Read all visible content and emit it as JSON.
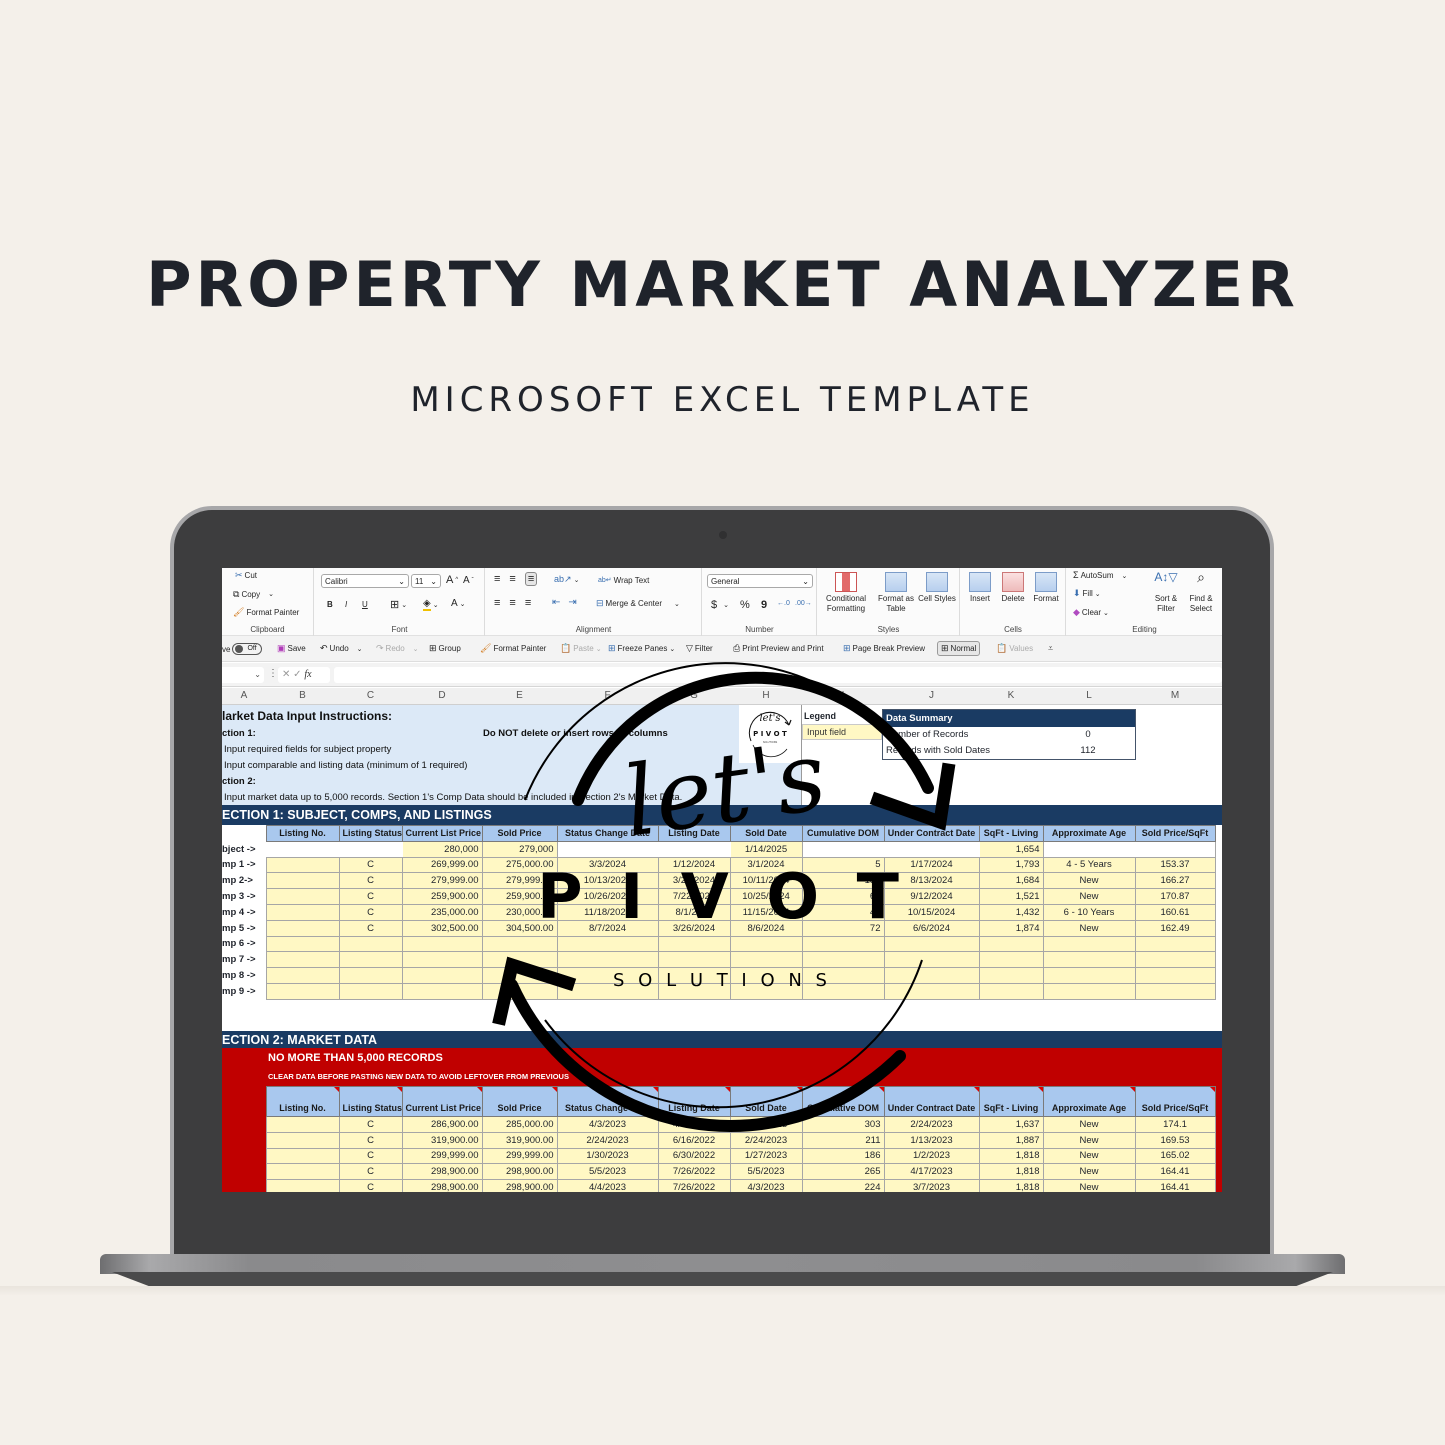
{
  "hero": {
    "title": "PROPERTY MARKET ANALYZER",
    "subtitle": "MICROSOFT EXCEL TEMPLATE"
  },
  "ribbon": {
    "clipboard": {
      "cut": "Cut",
      "copy": "Copy",
      "format_painter": "Format Painter",
      "label": "Clipboard"
    },
    "font": {
      "name": "Calibri",
      "size": "11",
      "label": "Font",
      "bold": "B",
      "italic": "I",
      "underline": "U"
    },
    "alignment": {
      "wrap_text": "Wrap Text",
      "merge_center": "Merge & Center",
      "label": "Alignment"
    },
    "number": {
      "format": "General",
      "label": "Number",
      "currency": "$",
      "percent": "%",
      "comma": "9"
    },
    "styles": {
      "conditional_formatting": "Conditional Formatting",
      "format_as_table": "Format as Table",
      "cell_styles": "Cell Styles",
      "label": "Styles"
    },
    "cells": {
      "insert": "Insert",
      "delete": "Delete",
      "format": "Format",
      "label": "Cells"
    },
    "editing": {
      "autosum": "AutoSum",
      "fill": "Fill",
      "clear": "Clear",
      "sort_filter": "Sort & Filter",
      "find_select": "Find & Select",
      "label": "Editing"
    }
  },
  "quick_access": {
    "autosave_partial": "ve",
    "autosave_state": "Off",
    "save": "Save",
    "undo": "Undo",
    "redo": "Redo",
    "group": "Group",
    "format_painter": "Format Painter",
    "paste": "Paste",
    "freeze_panes": "Freeze Panes",
    "filter": "Filter",
    "print_preview": "Print Preview and Print",
    "page_break_preview": "Page Break Preview",
    "normal": "Normal",
    "values": "Values"
  },
  "formula_bar": {
    "fx": "fx",
    "value": ""
  },
  "columns": [
    "A",
    "B",
    "C",
    "D",
    "E",
    "F",
    "G",
    "H",
    "I",
    "J",
    "K",
    "L",
    "M"
  ],
  "instructions": {
    "title": "larket Data Input Instructions:",
    "section1": "ction 1:",
    "warning": "Do NOT delete or insert rows or columns",
    "step1": "Input required fields for subject property",
    "step2": "Input comparable and listing data (minimum of 1 required)",
    "section2": "ction 2:",
    "step3": "Input market data up to 5,000 records. Section 1's Comp Data should be included in Section 2's Market Data."
  },
  "legend": {
    "title": "Legend",
    "input_field": "Input field"
  },
  "data_summary": {
    "title": "Data Summary",
    "rows": [
      {
        "label": "Number of Records",
        "value": "0"
      },
      {
        "label": "Records with Sold Dates",
        "value": "112"
      }
    ]
  },
  "section1": {
    "title": "ECTION 1: SUBJECT, COMPS, AND LISTINGS",
    "headers": [
      "Listing No.",
      "Listing Status",
      "Current List Price",
      "Sold Price",
      "Status Change Date",
      "Listing Date",
      "Sold Date",
      "Cumulative DOM",
      "Under Contract Date",
      "SqFt - Living",
      "Approximate Age",
      "Sold Price/SqFt"
    ],
    "rows": [
      {
        "label": "bject ->",
        "cells": [
          "",
          "",
          "280,000",
          "279,000",
          "",
          "",
          "1/14/2025",
          "",
          "",
          "1,654",
          "",
          ""
        ]
      },
      {
        "label": "mp 1 ->",
        "cells": [
          "",
          "C",
          "269,999.00",
          "275,000.00",
          "3/3/2024",
          "1/12/2024",
          "3/1/2024",
          "5",
          "1/17/2024",
          "1,793",
          "4 - 5 Years",
          "153.37"
        ]
      },
      {
        "label": "mp 2->",
        "cells": [
          "",
          "C",
          "279,999.00",
          "279,999.00",
          "10/13/2024",
          "3/27/2024",
          "10/11/2024",
          "152",
          "8/13/2024",
          "1,684",
          "New",
          "166.27"
        ]
      },
      {
        "label": "mp 3 ->",
        "cells": [
          "",
          "C",
          "259,900.00",
          "259,900.00",
          "10/26/2024",
          "7/22/2024",
          "10/25/2024",
          "68",
          "9/12/2024",
          "1,521",
          "New",
          "170.87"
        ]
      },
      {
        "label": "mp 4 ->",
        "cells": [
          "",
          "C",
          "235,000.00",
          "230,000.00",
          "11/18/2024",
          "8/1/2024",
          "11/15/2024",
          "47",
          "10/15/2024",
          "1,432",
          "6 - 10 Years",
          "160.61"
        ]
      },
      {
        "label": "mp 5 ->",
        "cells": [
          "",
          "C",
          "302,500.00",
          "304,500.00",
          "8/7/2024",
          "3/26/2024",
          "8/6/2024",
          "72",
          "6/6/2024",
          "1,874",
          "New",
          "162.49"
        ]
      },
      {
        "label": "mp 6 ->",
        "cells": [
          "",
          "",
          "",
          "",
          "",
          "",
          "",
          "",
          "",
          "",
          "",
          ""
        ]
      },
      {
        "label": "mp 7 ->",
        "cells": [
          "",
          "",
          "",
          "",
          "",
          "",
          "",
          "",
          "",
          "",
          "",
          ""
        ]
      },
      {
        "label": "mp 8 ->",
        "cells": [
          "",
          "",
          "",
          "",
          "",
          "",
          "",
          "",
          "",
          "",
          "",
          ""
        ]
      },
      {
        "label": "mp 9 ->",
        "cells": [
          "",
          "",
          "",
          "",
          "",
          "",
          "",
          "",
          "",
          "",
          "",
          ""
        ]
      }
    ]
  },
  "section2": {
    "title": "ECTION 2: MARKET DATA",
    "warning1": "NO MORE THAN 5,000 RECORDS",
    "warning2": "CLEAR DATA BEFORE PASTING NEW DATA TO AVOID LEFTOVER FROM PREVIOUS",
    "headers": [
      "Listing No.",
      "Listing Status",
      "Current List Price",
      "Sold Price",
      "Status Change Date",
      "Listing Date",
      "Sold Date",
      "Cumulative DOM",
      "Under Contract Date",
      "SqFt - Living",
      "Approximate Age",
      "Sold Price/SqFt"
    ],
    "rows": [
      [
        "",
        "C",
        "286,900.00",
        "285,000.00",
        "4/3/2023",
        "4/19/2022",
        "3/31/2023",
        "303",
        "2/24/2023",
        "1,637",
        "New",
        "174.1"
      ],
      [
        "",
        "C",
        "319,900.00",
        "319,900.00",
        "2/24/2023",
        "6/16/2022",
        "2/24/2023",
        "211",
        "1/13/2023",
        "1,887",
        "New",
        "169.53"
      ],
      [
        "",
        "C",
        "299,999.00",
        "299,999.00",
        "1/30/2023",
        "6/30/2022",
        "1/27/2023",
        "186",
        "1/2/2023",
        "1,818",
        "New",
        "165.02"
      ],
      [
        "",
        "C",
        "298,900.00",
        "298,900.00",
        "5/5/2023",
        "7/26/2022",
        "5/5/2023",
        "265",
        "4/17/2023",
        "1,818",
        "New",
        "164.41"
      ],
      [
        "",
        "C",
        "298,900.00",
        "298,900.00",
        "4/4/2023",
        "7/26/2022",
        "4/3/2023",
        "224",
        "3/7/2023",
        "1,818",
        "New",
        "164.41"
      ]
    ]
  },
  "watermark": {
    "script": "let's",
    "word": "P I V O T",
    "sub": "S O L U T I O N S",
    "mini_script": "let's",
    "mini_word": "P I V O T",
    "mini_sub": "SOLUTIONS"
  },
  "colors": {
    "background": "#f4f0ea",
    "header_navy": "#1a3b63",
    "header_blue": "#a9c8ee",
    "input_yellow": "#fff8c4",
    "instructions_blue": "#dce9f7",
    "warning_red": "#c00000"
  }
}
